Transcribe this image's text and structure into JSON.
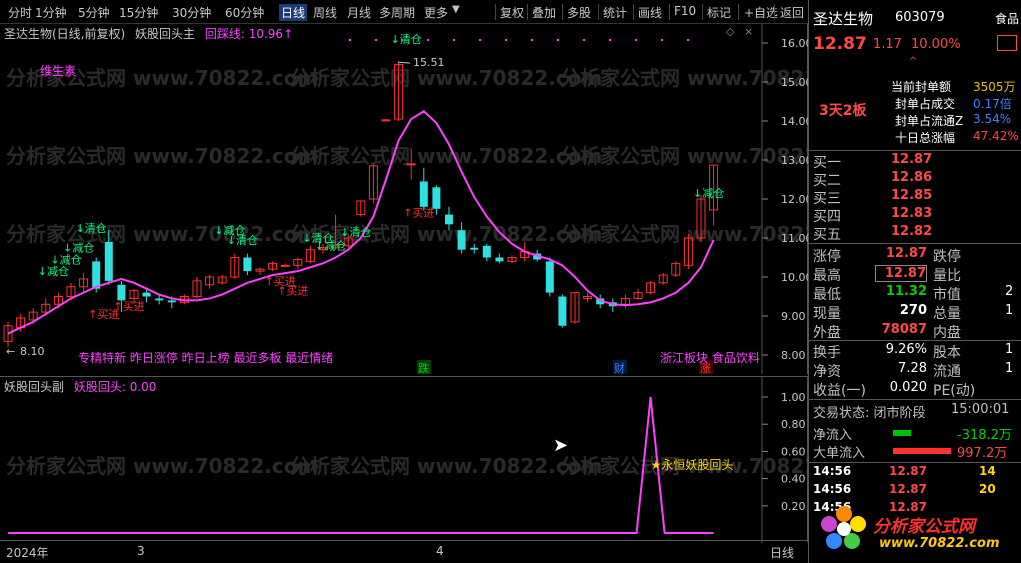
{
  "toolbar": {
    "items": [
      {
        "label": "分时",
        "active": false
      },
      {
        "label": "1分钟",
        "active": false
      },
      {
        "label": "5分钟",
        "active": false
      },
      {
        "label": "15分钟",
        "active": false
      },
      {
        "label": "30分钟",
        "active": false
      },
      {
        "label": "60分钟",
        "active": false
      },
      {
        "label": "日线",
        "active": true
      },
      {
        "label": "周线",
        "active": false
      },
      {
        "label": "月线",
        "active": false
      },
      {
        "label": "多周期",
        "active": false
      },
      {
        "label": "更多",
        "active": false
      },
      {
        "label": "复权",
        "active": false
      },
      {
        "label": "叠加",
        "active": false
      },
      {
        "label": "多股",
        "active": false
      },
      {
        "label": "统计",
        "active": false
      },
      {
        "label": "画线",
        "active": false
      },
      {
        "label": "F10",
        "active": false
      },
      {
        "label": "标记",
        "active": false
      },
      {
        "label": "+自选",
        "active": false
      },
      {
        "label": "返回",
        "active": false
      }
    ]
  },
  "watermark": "分析家公式网 www.70822.com",
  "main_chart": {
    "stock_label": "圣达生物(日线,前复权)",
    "indicator_name": "妖股回头主",
    "indicator_line_label": "回踩线: 10.96↑",
    "high_label": "15.51",
    "low_label": "8.10",
    "tag_vitamin": "维生素",
    "concepts": "专精特新 昨日涨停 昨日上榜 最近多板 最近情绪",
    "sector": "浙江板块 食品饮料",
    "event_die": "跌",
    "event_cai": "财",
    "event_zhang": "涨",
    "price_ticks": [
      "16.00",
      "15.00",
      "14.00",
      "13.00",
      "12.00",
      "11.00",
      "10.00",
      "9.00",
      "8.00"
    ]
  },
  "sub_chart": {
    "name": "妖股回头副",
    "line_label": "妖股回头: 0.00",
    "signal_label": "★永恒妖股回头",
    "ticks": [
      "1.00",
      "0.80",
      "0.60",
      "0.40",
      "0.20"
    ]
  },
  "date_axis": {
    "labels": [
      "2024年",
      "3",
      "4"
    ],
    "period": "日线"
  },
  "right_panel": {
    "name": "圣达生物",
    "code": "603079",
    "corner_label": "食品",
    "price": "12.87",
    "change": "1.17",
    "change_pct": "10.00%",
    "board_label": "3天2板",
    "seal_stats": [
      {
        "label": "当前封单额",
        "value": "3505万",
        "color": "#e8c000"
      },
      {
        "label": "封单占成交",
        "value": "0.17倍",
        "color": "#4080ff"
      },
      {
        "label": "封单占流通Z",
        "value": "3.54%",
        "color": "#4080ff"
      },
      {
        "label": "十日总涨幅",
        "value": "47.42%",
        "color": "#ff4848"
      }
    ],
    "order_book": [
      {
        "label": "买一",
        "price": "12.87",
        "vol": ""
      },
      {
        "label": "买二",
        "price": "12.86",
        "vol": ""
      },
      {
        "label": "买三",
        "price": "12.85",
        "vol": ""
      },
      {
        "label": "买四",
        "price": "12.83",
        "vol": ""
      },
      {
        "label": "买五",
        "price": "12.82",
        "vol": ""
      }
    ],
    "stats_left": [
      {
        "label": "涨停",
        "value": "12.87",
        "color": "#ff4848"
      },
      {
        "label": "最高",
        "value": "12.87",
        "color": "#ff4848"
      },
      {
        "label": "最低",
        "value": "11.32",
        "color": "#00d000"
      },
      {
        "label": "现量",
        "value": "270",
        "color": "#ffffff"
      },
      {
        "label": "外盘",
        "value": "78087",
        "color": "#ff4848"
      }
    ],
    "stats_right": [
      {
        "label": "跌停",
        "value": ""
      },
      {
        "label": "量比",
        "value": ""
      },
      {
        "label": "市值",
        "value": "2"
      },
      {
        "label": "总量",
        "value": "1"
      },
      {
        "label": "内盘",
        "value": ""
      }
    ],
    "stats2": [
      {
        "label": "换手",
        "value": "9.26%",
        "label2": "股本",
        "value2": "1"
      },
      {
        "label": "净资",
        "value": "7.28",
        "label2": "流通",
        "value2": "1"
      },
      {
        "label": "收益(一)",
        "value": "0.020",
        "label2": "PE(动)",
        "value2": ""
      }
    ],
    "trade_state_label": "交易状态: 闭市阶段",
    "trade_time": "15:00:01",
    "net_inflow_label": "净流入",
    "net_inflow_value": "-318.2万",
    "big_inflow_label": "大单流入",
    "big_inflow_value": "997.2万",
    "ticks": [
      {
        "time": "14:56",
        "price": "12.87",
        "vol": "14"
      },
      {
        "time": "14:56",
        "price": "12.87",
        "vol": "20"
      },
      {
        "time": "14:56",
        "price": "12.87",
        "vol": ""
      }
    ],
    "logo_text": "分析家公式网",
    "logo_url": "www.70822.com"
  },
  "chart_data": [
    {
      "type": "candlestick",
      "title": "妖股回头主",
      "ylim": [
        8.0,
        16.0
      ],
      "candles": [
        {
          "o": 8.35,
          "c": 8.75,
          "h": 8.85,
          "l": 8.2
        },
        {
          "o": 8.7,
          "c": 8.95,
          "h": 9.05,
          "l": 8.6
        },
        {
          "o": 8.9,
          "c": 9.1,
          "h": 9.2,
          "l": 8.8
        },
        {
          "o": 9.1,
          "c": 9.3,
          "h": 9.45,
          "l": 9.0
        },
        {
          "o": 9.3,
          "c": 9.5,
          "h": 9.6,
          "l": 9.2
        },
        {
          "o": 9.5,
          "c": 9.75,
          "h": 9.85,
          "l": 9.4
        },
        {
          "o": 9.75,
          "c": 9.95,
          "h": 10.1,
          "l": 9.6
        },
        {
          "o": 10.4,
          "c": 9.7,
          "h": 10.5,
          "l": 9.6
        },
        {
          "o": 10.9,
          "c": 9.9,
          "h": 11.2,
          "l": 9.8
        },
        {
          "o": 9.8,
          "c": 9.4,
          "h": 9.9,
          "l": 9.1
        },
        {
          "o": 9.45,
          "c": 9.65,
          "h": 9.7,
          "l": 9.3
        },
        {
          "o": 9.6,
          "c": 9.5,
          "h": 9.7,
          "l": 9.35
        },
        {
          "o": 9.45,
          "c": 9.4,
          "h": 9.55,
          "l": 9.3
        },
        {
          "o": 9.4,
          "c": 9.35,
          "h": 9.5,
          "l": 9.2
        },
        {
          "o": 9.35,
          "c": 9.5,
          "h": 9.55,
          "l": 9.3
        },
        {
          "o": 9.5,
          "c": 9.9,
          "h": 10.0,
          "l": 9.45
        },
        {
          "o": 9.8,
          "c": 10.0,
          "h": 10.05,
          "l": 9.7
        },
        {
          "o": 9.85,
          "c": 10.0,
          "h": 10.05,
          "l": 9.8
        },
        {
          "o": 10.0,
          "c": 10.5,
          "h": 10.6,
          "l": 9.95
        },
        {
          "o": 10.5,
          "c": 10.15,
          "h": 10.6,
          "l": 10.05
        },
        {
          "o": 10.15,
          "c": 10.2,
          "h": 10.25,
          "l": 10.05
        },
        {
          "o": 10.2,
          "c": 10.35,
          "h": 10.4,
          "l": 10.15
        },
        {
          "o": 10.3,
          "c": 10.3,
          "h": 10.35,
          "l": 10.25
        },
        {
          "o": 10.3,
          "c": 10.45,
          "h": 10.5,
          "l": 10.2
        },
        {
          "o": 10.4,
          "c": 10.7,
          "h": 10.8,
          "l": 10.35
        },
        {
          "o": 10.7,
          "c": 10.75,
          "h": 10.85,
          "l": 10.6
        },
        {
          "o": 10.75,
          "c": 10.8,
          "h": 11.6,
          "l": 10.7
        },
        {
          "o": 10.8,
          "c": 11.0,
          "h": 11.1,
          "l": 10.75
        },
        {
          "o": 11.6,
          "c": 11.95,
          "h": 11.95,
          "l": 11.55
        },
        {
          "o": 12.0,
          "c": 12.85,
          "h": 12.9,
          "l": 11.9
        },
        {
          "o": 14.03,
          "c": 14.03,
          "h": 14.05,
          "l": 14.0
        },
        {
          "o": 14.05,
          "c": 15.45,
          "h": 15.51,
          "l": 14.0
        },
        {
          "o": 12.9,
          "c": 12.9,
          "h": 13.3,
          "l": 12.5
        },
        {
          "o": 12.45,
          "c": 11.8,
          "h": 12.8,
          "l": 11.7
        },
        {
          "o": 12.3,
          "c": 11.75,
          "h": 12.35,
          "l": 11.6
        },
        {
          "o": 11.6,
          "c": 11.35,
          "h": 11.8,
          "l": 11.2
        },
        {
          "o": 11.2,
          "c": 10.7,
          "h": 11.4,
          "l": 10.6
        },
        {
          "o": 10.75,
          "c": 10.7,
          "h": 10.85,
          "l": 10.6
        },
        {
          "o": 10.8,
          "c": 10.5,
          "h": 10.85,
          "l": 10.4
        },
        {
          "o": 10.5,
          "c": 10.4,
          "h": 10.6,
          "l": 10.35
        },
        {
          "o": 10.4,
          "c": 10.5,
          "h": 10.55,
          "l": 10.35
        },
        {
          "o": 10.5,
          "c": 10.65,
          "h": 10.9,
          "l": 10.4
        },
        {
          "o": 10.6,
          "c": 10.45,
          "h": 10.7,
          "l": 10.4
        },
        {
          "o": 10.4,
          "c": 9.6,
          "h": 10.5,
          "l": 9.5
        },
        {
          "o": 9.5,
          "c": 8.75,
          "h": 9.55,
          "l": 8.7
        },
        {
          "o": 8.85,
          "c": 9.6,
          "h": 9.6,
          "l": 8.8
        },
        {
          "o": 9.45,
          "c": 9.5,
          "h": 9.6,
          "l": 9.35
        },
        {
          "o": 9.45,
          "c": 9.3,
          "h": 9.55,
          "l": 9.2
        },
        {
          "o": 9.35,
          "c": 9.25,
          "h": 9.45,
          "l": 9.1
        },
        {
          "o": 9.3,
          "c": 9.45,
          "h": 9.55,
          "l": 9.2
        },
        {
          "o": 9.45,
          "c": 9.6,
          "h": 9.7,
          "l": 9.4
        },
        {
          "o": 9.6,
          "c": 9.85,
          "h": 9.9,
          "l": 9.55
        },
        {
          "o": 9.85,
          "c": 10.05,
          "h": 10.1,
          "l": 9.8
        },
        {
          "o": 10.05,
          "c": 10.35,
          "h": 10.4,
          "l": 10.0
        },
        {
          "o": 10.3,
          "c": 11.0,
          "h": 11.1,
          "l": 10.2
        },
        {
          "o": 11.0,
          "c": 12.0,
          "h": 12.1,
          "l": 10.9
        },
        {
          "o": 11.72,
          "c": 12.87,
          "h": 12.87,
          "l": 11.32
        }
      ],
      "ma_line": [
        8.55,
        8.7,
        8.85,
        9.05,
        9.25,
        9.45,
        9.6,
        9.75,
        9.85,
        9.95,
        9.85,
        9.7,
        9.55,
        9.45,
        9.4,
        9.4,
        9.45,
        9.55,
        9.7,
        9.85,
        9.95,
        10.05,
        10.1,
        10.15,
        10.25,
        10.35,
        10.5,
        10.7,
        11.0,
        11.55,
        12.5,
        13.5,
        14.05,
        14.25,
        13.95,
        13.4,
        12.7,
        12.05,
        11.55,
        11.15,
        10.85,
        10.65,
        10.55,
        10.45,
        10.3,
        10.0,
        9.65,
        9.4,
        9.3,
        9.28,
        9.3,
        9.35,
        9.45,
        9.6,
        9.85,
        10.25,
        10.95
      ],
      "signals": [
        {
          "bar": 3,
          "text": "↓减仓",
          "color": "#00ff80",
          "price": 10.05
        },
        {
          "bar": 4,
          "text": "↓减仓",
          "color": "#00ff80",
          "price": 10.35
        },
        {
          "bar": 5,
          "text": "↓减仓",
          "color": "#00ff80",
          "price": 10.65
        },
        {
          "bar": 6,
          "text": "↓清仓",
          "color": "#00ff80",
          "price": 11.15
        },
        {
          "bar": 7,
          "text": "↑买进",
          "color": "#ff3030",
          "price": 8.95
        },
        {
          "bar": 9,
          "text": "↑买进",
          "color": "#ff3030",
          "price": 9.15
        },
        {
          "bar": 17,
          "text": "↓减仓",
          "color": "#00ff80",
          "price": 11.1
        },
        {
          "bar": 18,
          "text": "↓清仓",
          "color": "#00ff80",
          "price": 10.85
        },
        {
          "bar": 21,
          "text": "↑买进",
          "color": "#ff3030",
          "price": 9.8
        },
        {
          "bar": 22,
          "text": "↑买进",
          "color": "#ff3030",
          "price": 9.55
        },
        {
          "bar": 24,
          "text": "↓清仓",
          "color": "#00ff80",
          "price": 10.9
        },
        {
          "bar": 25,
          "text": "↓减仓",
          "color": "#00ff80",
          "price": 10.7
        },
        {
          "bar": 27,
          "text": "↓清仓",
          "color": "#00ff80",
          "price": 11.05
        },
        {
          "bar": 32,
          "text": "↑买进",
          "color": "#ff3030",
          "price": 11.55
        },
        {
          "bar": 31,
          "text": "↓清仓",
          "color": "#00ff80",
          "price": 16.0
        },
        {
          "bar": 55,
          "text": "↓减仓",
          "color": "#00ff80",
          "price": 12.05
        }
      ]
    },
    {
      "type": "line",
      "title": "妖股回头副",
      "ylim": [
        0,
        1.0
      ],
      "x_count": 57,
      "values_note_free": true,
      "spike": {
        "bar": 51,
        "value": 1.0,
        "baseline": 0.0
      }
    }
  ]
}
